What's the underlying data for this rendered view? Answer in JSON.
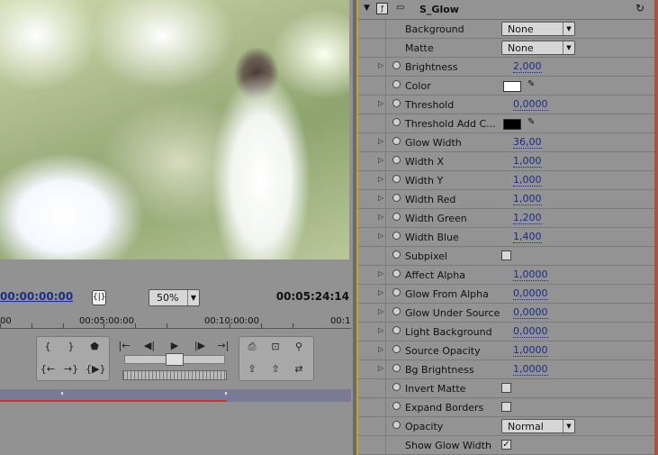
{
  "monitor": {
    "current_timecode": "00:00:00:00",
    "zoom": "50%",
    "duration": "00:05:24:14",
    "ruler": [
      "00",
      "00:05:00:00",
      "00:10:00:00",
      "00:1"
    ]
  },
  "effect": {
    "name": "S_Glow",
    "params": [
      {
        "label": "Background",
        "type": "dropdown",
        "value": "None",
        "twirl": false,
        "stopwatch": false
      },
      {
        "label": "Matte",
        "type": "dropdown",
        "value": "None",
        "twirl": false,
        "stopwatch": false
      },
      {
        "label": "Brightness",
        "type": "value",
        "value": "2,000",
        "twirl": true,
        "stopwatch": true
      },
      {
        "label": "Color",
        "type": "color",
        "color": "#ffffff",
        "twirl": false,
        "stopwatch": true
      },
      {
        "label": "Threshold",
        "type": "value",
        "value": "0,0000",
        "twirl": true,
        "stopwatch": true
      },
      {
        "label": "Threshold Add C...",
        "type": "color",
        "color": "#000000",
        "twirl": false,
        "stopwatch": true
      },
      {
        "label": "Glow Width",
        "type": "value",
        "value": "36,00",
        "twirl": true,
        "stopwatch": true
      },
      {
        "label": "Width X",
        "type": "value",
        "value": "1,000",
        "twirl": true,
        "stopwatch": true
      },
      {
        "label": "Width Y",
        "type": "value",
        "value": "1,000",
        "twirl": true,
        "stopwatch": true
      },
      {
        "label": "Width Red",
        "type": "value",
        "value": "1,000",
        "twirl": true,
        "stopwatch": true
      },
      {
        "label": "Width Green",
        "type": "value",
        "value": "1,200",
        "twirl": true,
        "stopwatch": true
      },
      {
        "label": "Width Blue",
        "type": "value",
        "value": "1,400",
        "twirl": true,
        "stopwatch": true
      },
      {
        "label": "Subpixel",
        "type": "checkbox",
        "checked": false,
        "twirl": false,
        "stopwatch": true
      },
      {
        "label": "Affect Alpha",
        "type": "value",
        "value": "1,0000",
        "twirl": true,
        "stopwatch": true
      },
      {
        "label": "Glow From Alpha",
        "type": "value",
        "value": "0,0000",
        "twirl": true,
        "stopwatch": true
      },
      {
        "label": "Glow Under Source",
        "type": "value",
        "value": "0,0000",
        "twirl": true,
        "stopwatch": true
      },
      {
        "label": "Light Background",
        "type": "value",
        "value": "0,0000",
        "twirl": true,
        "stopwatch": true
      },
      {
        "label": "Source Opacity",
        "type": "value",
        "value": "1,0000",
        "twirl": true,
        "stopwatch": true
      },
      {
        "label": "Bg Brightness",
        "type": "value",
        "value": "1,0000",
        "twirl": true,
        "stopwatch": true
      },
      {
        "label": "Invert Matte",
        "type": "checkbox",
        "checked": false,
        "twirl": false,
        "stopwatch": true
      },
      {
        "label": "Expand Borders",
        "type": "checkbox",
        "checked": false,
        "twirl": false,
        "stopwatch": true
      },
      {
        "label": "Opacity",
        "type": "dropdown",
        "value": "Normal",
        "twirl": false,
        "stopwatch": true
      },
      {
        "label": "Show Glow Width",
        "type": "checkbox",
        "checked": true,
        "twirl": false,
        "stopwatch": false
      }
    ]
  }
}
